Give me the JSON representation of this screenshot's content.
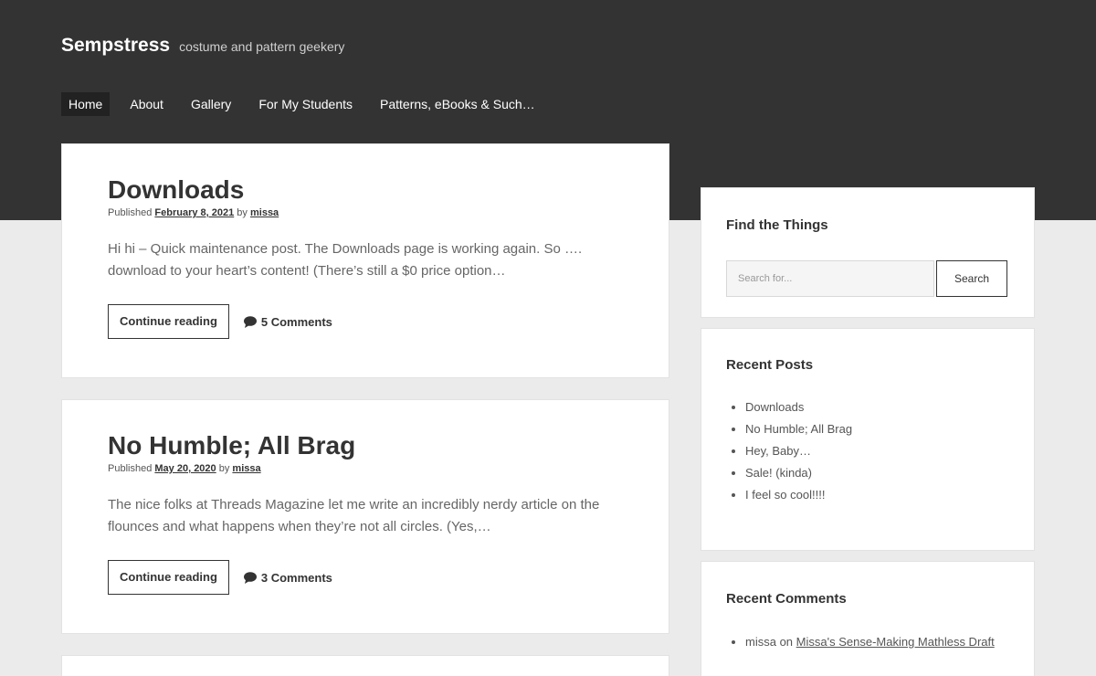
{
  "site": {
    "title": "Sempstress",
    "tagline": "costume and pattern geekery"
  },
  "nav": {
    "items": [
      {
        "label": "Home",
        "active": true
      },
      {
        "label": "About"
      },
      {
        "label": "Gallery"
      },
      {
        "label": "For My Students"
      },
      {
        "label": "Patterns, eBooks & Such…"
      }
    ]
  },
  "posts": [
    {
      "title": "Downloads",
      "published_label": "Published",
      "date": "February 8, 2021",
      "by_label": "by",
      "author": "missa",
      "excerpt": "Hi hi – Quick maintenance post.  The Downloads page is working again.  So …. download to your heart’s content!  (There’s still a $0 price option…",
      "continue_label": "Continue reading",
      "comments_label": "5 Comments"
    },
    {
      "title": "No Humble; All Brag",
      "published_label": "Published",
      "date": "May 20, 2020",
      "by_label": "by",
      "author": "missa",
      "excerpt": "The nice folks at Threads Magazine let me write an incredibly nerdy article on the flounces and what happens when they’re not all circles. (Yes,…",
      "continue_label": "Continue reading",
      "comments_label": "3 Comments"
    }
  ],
  "sidebar": {
    "search": {
      "heading": "Find the Things",
      "placeholder": "Search for...",
      "button_label": "Search"
    },
    "recent_posts": {
      "heading": "Recent Posts",
      "items": [
        "Downloads",
        "No Humble; All Brag",
        "Hey, Baby…",
        "Sale! (kinda)",
        "I feel so cool!!!!"
      ]
    },
    "recent_comments": {
      "heading": "Recent Comments",
      "items": [
        {
          "author": "missa",
          "on_label": "on",
          "post": "Missa's Sense-Making Mathless Draft"
        }
      ]
    }
  },
  "icons": {
    "comment": "speech-bubble-icon"
  },
  "colors": {
    "header_bg": "#333333",
    "page_bg": "#ebebeb",
    "nav_active_bg": "#222222"
  }
}
